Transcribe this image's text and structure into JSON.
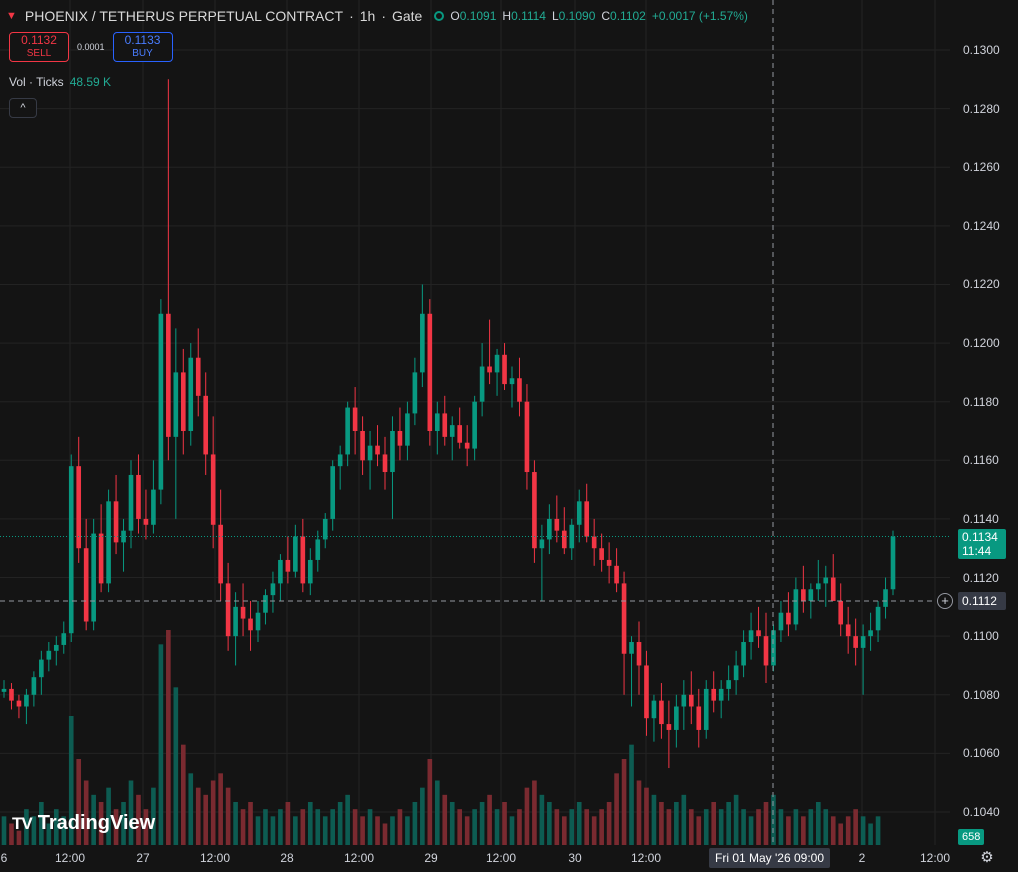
{
  "header": {
    "symbol": "PHOENIX / TETHERUS PERPETUAL CONTRACT",
    "interval": "1h",
    "exchange": "Gate",
    "sep": "·",
    "ohlc": {
      "o_label": "O",
      "o": "0.1091",
      "h_label": "H",
      "h": "0.1114",
      "l_label": "L",
      "l": "0.1090",
      "c_label": "C",
      "c": "0.1102",
      "change": "+0.0017 (+1.57%)"
    }
  },
  "trade": {
    "sell_price": "0.1132",
    "sell_label": "SELL",
    "spread": "0.0001",
    "buy_price": "0.1133",
    "buy_label": "BUY"
  },
  "volume_legend": {
    "label": "Vol · Ticks",
    "value": "48.59 K"
  },
  "collapse_glyph": "^",
  "price_axis": [
    "0.1300",
    "0.1280",
    "0.1260",
    "0.1240",
    "0.1220",
    "0.1200",
    "0.1180",
    "0.1160",
    "0.1140",
    "0.1120",
    "0.1100",
    "0.1080",
    "0.1060",
    "0.1040"
  ],
  "time_axis": [
    "6",
    "12:00",
    "27",
    "12:00",
    "28",
    "12:00",
    "29",
    "12:00",
    "30",
    "12:00",
    "2",
    "12:00"
  ],
  "crosshair": {
    "price_label": "0.1112",
    "date_label": "Fri 01 May '26  09:00"
  },
  "last_price": {
    "price": "0.1134",
    "countdown": "11:44"
  },
  "volume_tag": "658",
  "branding": {
    "logo_text": "TradingView",
    "mark": "TV"
  },
  "colors": {
    "up": "#089981",
    "down": "#f23645",
    "up_vol": "#0d5c52",
    "down_vol": "#7a2a30",
    "background": "#141414",
    "grid": "#232323"
  },
  "chart_data": {
    "type": "candlestick",
    "interval": "1h",
    "ylim": [
      0.1032,
      0.1308
    ],
    "y_ticks": [
      0.13,
      0.128,
      0.126,
      0.124,
      0.122,
      0.12,
      0.118,
      0.116,
      0.114,
      0.112,
      0.11,
      0.108,
      0.106,
      0.104
    ],
    "last_price": 0.1134,
    "crosshair_price": 0.1112,
    "candles": [
      [
        0.1081,
        0.1085,
        0.1079,
        0.1082
      ],
      [
        0.1082,
        0.1084,
        0.1075,
        0.1078
      ],
      [
        0.1078,
        0.108,
        0.1072,
        0.1076
      ],
      [
        0.1076,
        0.1082,
        0.107,
        0.108
      ],
      [
        0.108,
        0.1088,
        0.1076,
        0.1086
      ],
      [
        0.1086,
        0.1095,
        0.108,
        0.1092
      ],
      [
        0.1092,
        0.1098,
        0.1088,
        0.1095
      ],
      [
        0.1095,
        0.11,
        0.109,
        0.1097
      ],
      [
        0.1097,
        0.1105,
        0.1094,
        0.1101
      ],
      [
        0.1101,
        0.1162,
        0.1098,
        0.1158
      ],
      [
        0.1158,
        0.1168,
        0.1125,
        0.113
      ],
      [
        0.113,
        0.114,
        0.1102,
        0.1105
      ],
      [
        0.1105,
        0.114,
        0.1102,
        0.1135
      ],
      [
        0.1135,
        0.1145,
        0.1115,
        0.1118
      ],
      [
        0.1118,
        0.115,
        0.1115,
        0.1146
      ],
      [
        0.1146,
        0.1155,
        0.1128,
        0.1132
      ],
      [
        0.1132,
        0.114,
        0.1122,
        0.1136
      ],
      [
        0.1136,
        0.116,
        0.113,
        0.1155
      ],
      [
        0.1155,
        0.1162,
        0.1135,
        0.114
      ],
      [
        0.114,
        0.115,
        0.1133,
        0.1138
      ],
      [
        0.1138,
        0.116,
        0.1135,
        0.115
      ],
      [
        0.115,
        0.1215,
        0.1145,
        0.121
      ],
      [
        0.121,
        0.129,
        0.116,
        0.1168
      ],
      [
        0.1168,
        0.1205,
        0.114,
        0.119
      ],
      [
        0.119,
        0.1198,
        0.1162,
        0.117
      ],
      [
        0.117,
        0.12,
        0.1165,
        0.1195
      ],
      [
        0.1195,
        0.1205,
        0.1175,
        0.1182
      ],
      [
        0.1182,
        0.119,
        0.1155,
        0.1162
      ],
      [
        0.1162,
        0.1175,
        0.113,
        0.1138
      ],
      [
        0.1138,
        0.115,
        0.1112,
        0.1118
      ],
      [
        0.1118,
        0.1125,
        0.1095,
        0.11
      ],
      [
        0.11,
        0.1115,
        0.109,
        0.111
      ],
      [
        0.111,
        0.1118,
        0.11,
        0.1106
      ],
      [
        0.1106,
        0.1112,
        0.1095,
        0.1102
      ],
      [
        0.1102,
        0.1112,
        0.1098,
        0.1108
      ],
      [
        0.1108,
        0.1116,
        0.1104,
        0.1114
      ],
      [
        0.1114,
        0.1122,
        0.1108,
        0.1118
      ],
      [
        0.1118,
        0.1128,
        0.1112,
        0.1126
      ],
      [
        0.1126,
        0.1134,
        0.1118,
        0.1122
      ],
      [
        0.1122,
        0.1138,
        0.112,
        0.1134
      ],
      [
        0.1134,
        0.114,
        0.1115,
        0.1118
      ],
      [
        0.1118,
        0.113,
        0.1114,
        0.1126
      ],
      [
        0.1126,
        0.1136,
        0.1122,
        0.1133
      ],
      [
        0.1133,
        0.1142,
        0.113,
        0.114
      ],
      [
        0.114,
        0.116,
        0.1136,
        0.1158
      ],
      [
        0.1158,
        0.1165,
        0.115,
        0.1162
      ],
      [
        0.1162,
        0.118,
        0.1158,
        0.1178
      ],
      [
        0.1178,
        0.1185,
        0.1162,
        0.117
      ],
      [
        0.117,
        0.1175,
        0.1155,
        0.116
      ],
      [
        0.116,
        0.117,
        0.115,
        0.1165
      ],
      [
        0.1165,
        0.1172,
        0.1158,
        0.1162
      ],
      [
        0.1162,
        0.1168,
        0.115,
        0.1156
      ],
      [
        0.1156,
        0.1175,
        0.114,
        0.117
      ],
      [
        0.117,
        0.1178,
        0.116,
        0.1165
      ],
      [
        0.1165,
        0.118,
        0.116,
        0.1176
      ],
      [
        0.1176,
        0.1195,
        0.1172,
        0.119
      ],
      [
        0.119,
        0.122,
        0.1185,
        0.121
      ],
      [
        0.121,
        0.1215,
        0.1165,
        0.117
      ],
      [
        0.117,
        0.118,
        0.1162,
        0.1176
      ],
      [
        0.1176,
        0.1182,
        0.1165,
        0.1168
      ],
      [
        0.1168,
        0.1175,
        0.116,
        0.1172
      ],
      [
        0.1172,
        0.1178,
        0.1164,
        0.1166
      ],
      [
        0.1166,
        0.1172,
        0.1158,
        0.1164
      ],
      [
        0.1164,
        0.1182,
        0.116,
        0.118
      ],
      [
        0.118,
        0.12,
        0.1175,
        0.1192
      ],
      [
        0.1192,
        0.1208,
        0.1186,
        0.119
      ],
      [
        0.119,
        0.1198,
        0.1182,
        0.1196
      ],
      [
        0.1196,
        0.12,
        0.1184,
        0.1186
      ],
      [
        0.1186,
        0.1192,
        0.1178,
        0.1188
      ],
      [
        0.1188,
        0.1195,
        0.1175,
        0.118
      ],
      [
        0.118,
        0.1186,
        0.115,
        0.1156
      ],
      [
        0.1156,
        0.116,
        0.1125,
        0.113
      ],
      [
        0.113,
        0.1138,
        0.1112,
        0.1133
      ],
      [
        0.1133,
        0.1145,
        0.1128,
        0.114
      ],
      [
        0.114,
        0.1148,
        0.1132,
        0.1136
      ],
      [
        0.1136,
        0.1144,
        0.1128,
        0.113
      ],
      [
        0.113,
        0.114,
        0.1126,
        0.1138
      ],
      [
        0.1138,
        0.115,
        0.1132,
        0.1146
      ],
      [
        0.1146,
        0.1152,
        0.1132,
        0.1134
      ],
      [
        0.1134,
        0.114,
        0.1124,
        0.113
      ],
      [
        0.113,
        0.1135,
        0.1122,
        0.1126
      ],
      [
        0.1126,
        0.1132,
        0.1118,
        0.1124
      ],
      [
        0.1124,
        0.113,
        0.1115,
        0.1118
      ],
      [
        0.1118,
        0.1122,
        0.108,
        0.1094
      ],
      [
        0.1094,
        0.11,
        0.1076,
        0.1098
      ],
      [
        0.1098,
        0.1105,
        0.108,
        0.109
      ],
      [
        0.109,
        0.1095,
        0.1066,
        0.1072
      ],
      [
        0.1072,
        0.108,
        0.1064,
        0.1078
      ],
      [
        0.1078,
        0.1084,
        0.1065,
        0.107
      ],
      [
        0.107,
        0.1078,
        0.1055,
        0.1068
      ],
      [
        0.1068,
        0.108,
        0.1062,
        0.1076
      ],
      [
        0.1076,
        0.1085,
        0.1068,
        0.108
      ],
      [
        0.108,
        0.1088,
        0.107,
        0.1076
      ],
      [
        0.1076,
        0.1082,
        0.1062,
        0.1068
      ],
      [
        0.1068,
        0.1085,
        0.1065,
        0.1082
      ],
      [
        0.1082,
        0.1088,
        0.1074,
        0.1078
      ],
      [
        0.1078,
        0.1085,
        0.1072,
        0.1082
      ],
      [
        0.1082,
        0.109,
        0.1078,
        0.1085
      ],
      [
        0.1085,
        0.1095,
        0.108,
        0.109
      ],
      [
        0.109,
        0.1102,
        0.1086,
        0.1098
      ],
      [
        0.1098,
        0.1108,
        0.1092,
        0.1102
      ],
      [
        0.1102,
        0.111,
        0.1096,
        0.11
      ],
      [
        0.11,
        0.1108,
        0.1084,
        0.109
      ],
      [
        0.109,
        0.1104,
        0.1088,
        0.1102
      ],
      [
        0.1102,
        0.1112,
        0.1098,
        0.1108
      ],
      [
        0.1108,
        0.1115,
        0.11,
        0.1104
      ],
      [
        0.1104,
        0.112,
        0.1102,
        0.1116
      ],
      [
        0.1116,
        0.1124,
        0.1108,
        0.1112
      ],
      [
        0.1112,
        0.1118,
        0.1106,
        0.1116
      ],
      [
        0.1116,
        0.1126,
        0.1112,
        0.1118
      ],
      [
        0.1118,
        0.1124,
        0.111,
        0.112
      ],
      [
        0.112,
        0.1128,
        0.1116,
        0.1112
      ],
      [
        0.1112,
        0.1118,
        0.11,
        0.1104
      ],
      [
        0.1104,
        0.111,
        0.1094,
        0.11
      ],
      [
        0.11,
        0.1106,
        0.109,
        0.1096
      ],
      [
        0.1096,
        0.1104,
        0.108,
        0.11
      ],
      [
        0.11,
        0.1108,
        0.1095,
        0.1102
      ],
      [
        0.1102,
        0.1112,
        0.1098,
        0.111
      ],
      [
        0.111,
        0.112,
        0.1106,
        0.1116
      ],
      [
        0.1116,
        0.1136,
        0.1114,
        0.1134
      ]
    ],
    "volumes": [
      4,
      3,
      2,
      5,
      4,
      6,
      3,
      5,
      4,
      18,
      12,
      9,
      7,
      6,
      8,
      5,
      6,
      9,
      7,
      5,
      8,
      28,
      30,
      22,
      14,
      10,
      8,
      7,
      9,
      10,
      8,
      6,
      5,
      6,
      4,
      5,
      4,
      5,
      6,
      4,
      5,
      6,
      5,
      4,
      5,
      6,
      7,
      5,
      4,
      5,
      4,
      3,
      4,
      5,
      4,
      6,
      8,
      12,
      9,
      7,
      6,
      5,
      4,
      5,
      6,
      7,
      5,
      6,
      4,
      5,
      8,
      9,
      7,
      6,
      5,
      4,
      5,
      6,
      5,
      4,
      5,
      6,
      10,
      12,
      14,
      9,
      8,
      7,
      6,
      5,
      6,
      7,
      5,
      4,
      5,
      6,
      5,
      6,
      7,
      5,
      4,
      5,
      6,
      7,
      5,
      4,
      5,
      4,
      5,
      6,
      5,
      4,
      3,
      4,
      5,
      4,
      3,
      4
    ]
  }
}
